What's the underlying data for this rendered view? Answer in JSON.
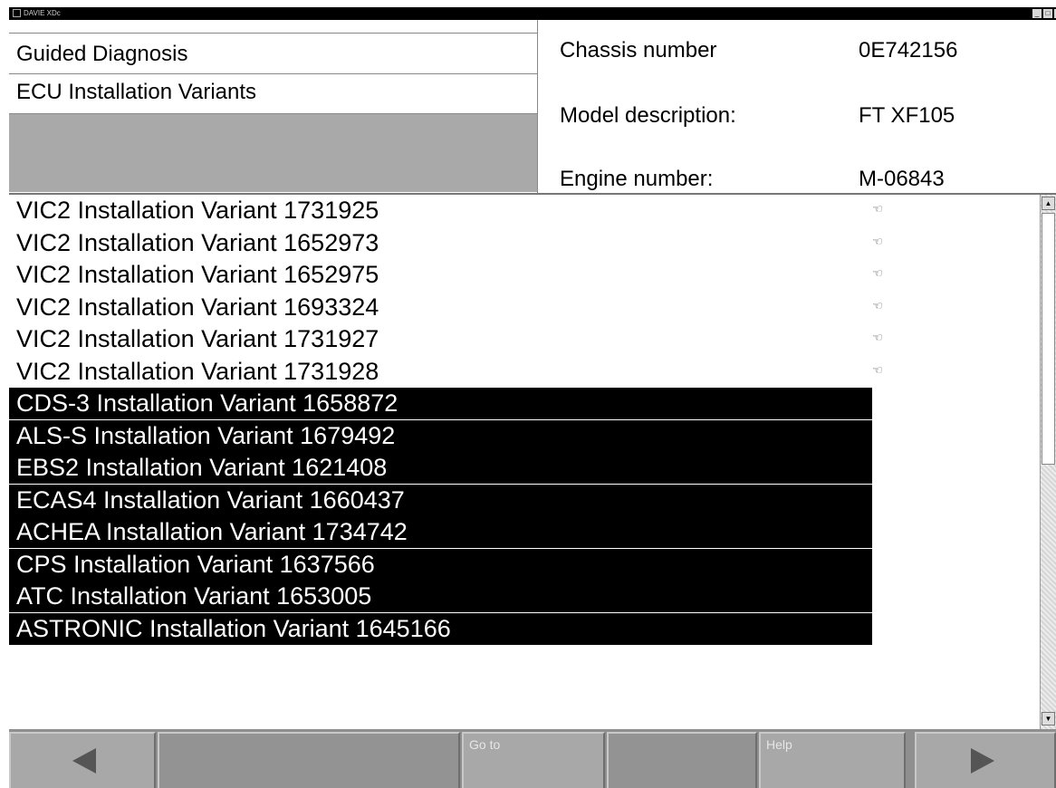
{
  "window": {
    "title": "DAVIE XDc",
    "controls": {
      "minimize": "_",
      "maximize": "□",
      "close": "x"
    }
  },
  "header": {
    "nav": {
      "guided_diagnosis": "Guided Diagnosis",
      "ecu_installation_variants": "ECU Installation Variants"
    },
    "vehicle": {
      "chassis_label": "Chassis number",
      "chassis_value": "0E742156",
      "model_label": "Model description:",
      "model_value": "FT XF105",
      "engine_label": "Engine number:",
      "engine_value": "M-06843"
    }
  },
  "list": {
    "items": [
      {
        "label": "VIC2 Installation Variant 1731925",
        "selected": false,
        "icon": "pointing-hand-icon"
      },
      {
        "label": "VIC2 Installation Variant 1652973",
        "selected": false,
        "icon": "pointing-hand-icon"
      },
      {
        "label": "VIC2 Installation Variant 1652975",
        "selected": false,
        "icon": "pointing-hand-icon"
      },
      {
        "label": "VIC2 Installation Variant 1693324",
        "selected": false,
        "icon": "pointing-hand-icon"
      },
      {
        "label": "VIC2 Installation Variant 1731927",
        "selected": false,
        "icon": "pointing-hand-icon"
      },
      {
        "label": "VIC2 Installation Variant 1731928",
        "selected": false,
        "icon": "pointing-hand-icon"
      },
      {
        "label": "CDS-3 Installation Variant 1658872",
        "selected": true
      },
      {
        "label": "ALS-S Installation Variant 1679492",
        "selected": true
      },
      {
        "label": "EBS2 Installation Variant 1621408",
        "selected": true
      },
      {
        "label": "ECAS4 Installation Variant 1660437",
        "selected": true
      },
      {
        "label": "ACHEA Installation Variant 1734742",
        "selected": true
      },
      {
        "label": "CPS Installation Variant 1637566",
        "selected": true
      },
      {
        "label": "ATC Installation Variant 1653005",
        "selected": true
      },
      {
        "label": "ASTRONIC Installation Variant 1645166",
        "selected": true
      }
    ],
    "row_icon_glyph": "☜"
  },
  "footer": {
    "back_icon": "left-arrow-icon",
    "goto_label": "Go to",
    "help_label": "Help",
    "forward_icon": "right-arrow-icon"
  },
  "colors": {
    "selected_bg": "#000000",
    "selected_fg": "#ffffff",
    "footer_bg": "#8f8f8f",
    "nav_blank": "#a9a9a9"
  }
}
